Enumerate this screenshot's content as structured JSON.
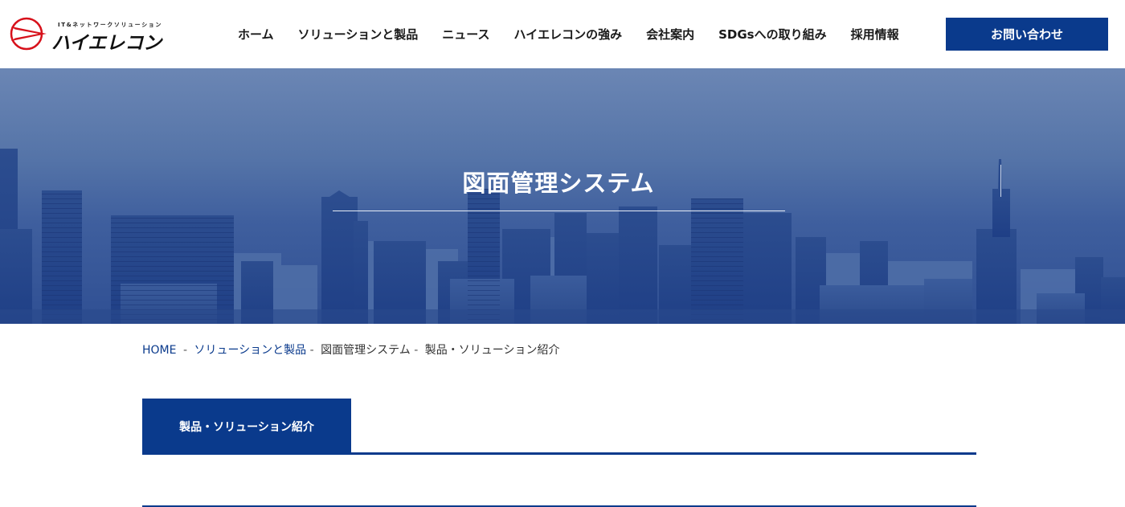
{
  "header": {
    "logo": {
      "tagline": "IT&ネットワークソリューション",
      "name": "ハイエレコン"
    },
    "nav": [
      {
        "label": "ホーム"
      },
      {
        "label": "ソリューションと製品"
      },
      {
        "label": "ニュース"
      },
      {
        "label": "ハイエレコンの強み"
      },
      {
        "label": "会社案内"
      },
      {
        "label": "SDGsへの取り組み"
      },
      {
        "label": "採用情報"
      }
    ],
    "contact_label": "お問い合わせ"
  },
  "hero": {
    "title": "図面管理システム"
  },
  "breadcrumb": {
    "home": "HOME",
    "solutions": "ソリューションと製品",
    "system": "図面管理システム",
    "current": "製品・ソリューション紹介",
    "separator": "-"
  },
  "tab": {
    "label": "製品・ソリューション紹介"
  },
  "colors": {
    "brand_blue": "#0a3a8c",
    "logo_red": "#d7111b"
  },
  "icons": {
    "logo_mark": "arrow-circle-logo-icon"
  }
}
